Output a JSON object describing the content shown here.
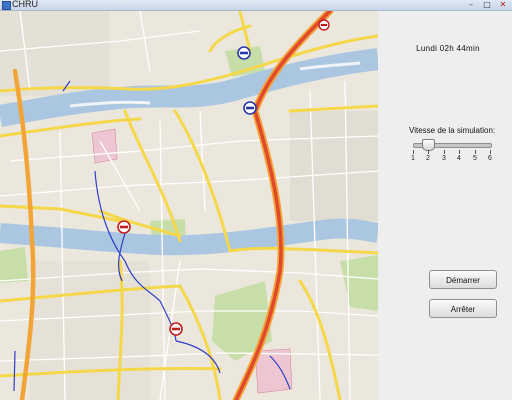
{
  "window": {
    "title": "CHRU",
    "minimize_glyph": "–",
    "maximize_glyph": "□",
    "close_glyph": "✕"
  },
  "map": {
    "icons": [
      "hospital-marker-icon",
      "ambulance-marker-icon"
    ]
  },
  "panel": {
    "clock": "Lundi 02h 44min",
    "speed_label": "Vitesse de la simulation:",
    "slider": {
      "min": 1,
      "max": 6,
      "value": 2,
      "tick_labels": [
        "1",
        "2",
        "3",
        "4",
        "5",
        "6"
      ]
    },
    "start_button": "Démarrer",
    "stop_button": "Arrêter"
  }
}
